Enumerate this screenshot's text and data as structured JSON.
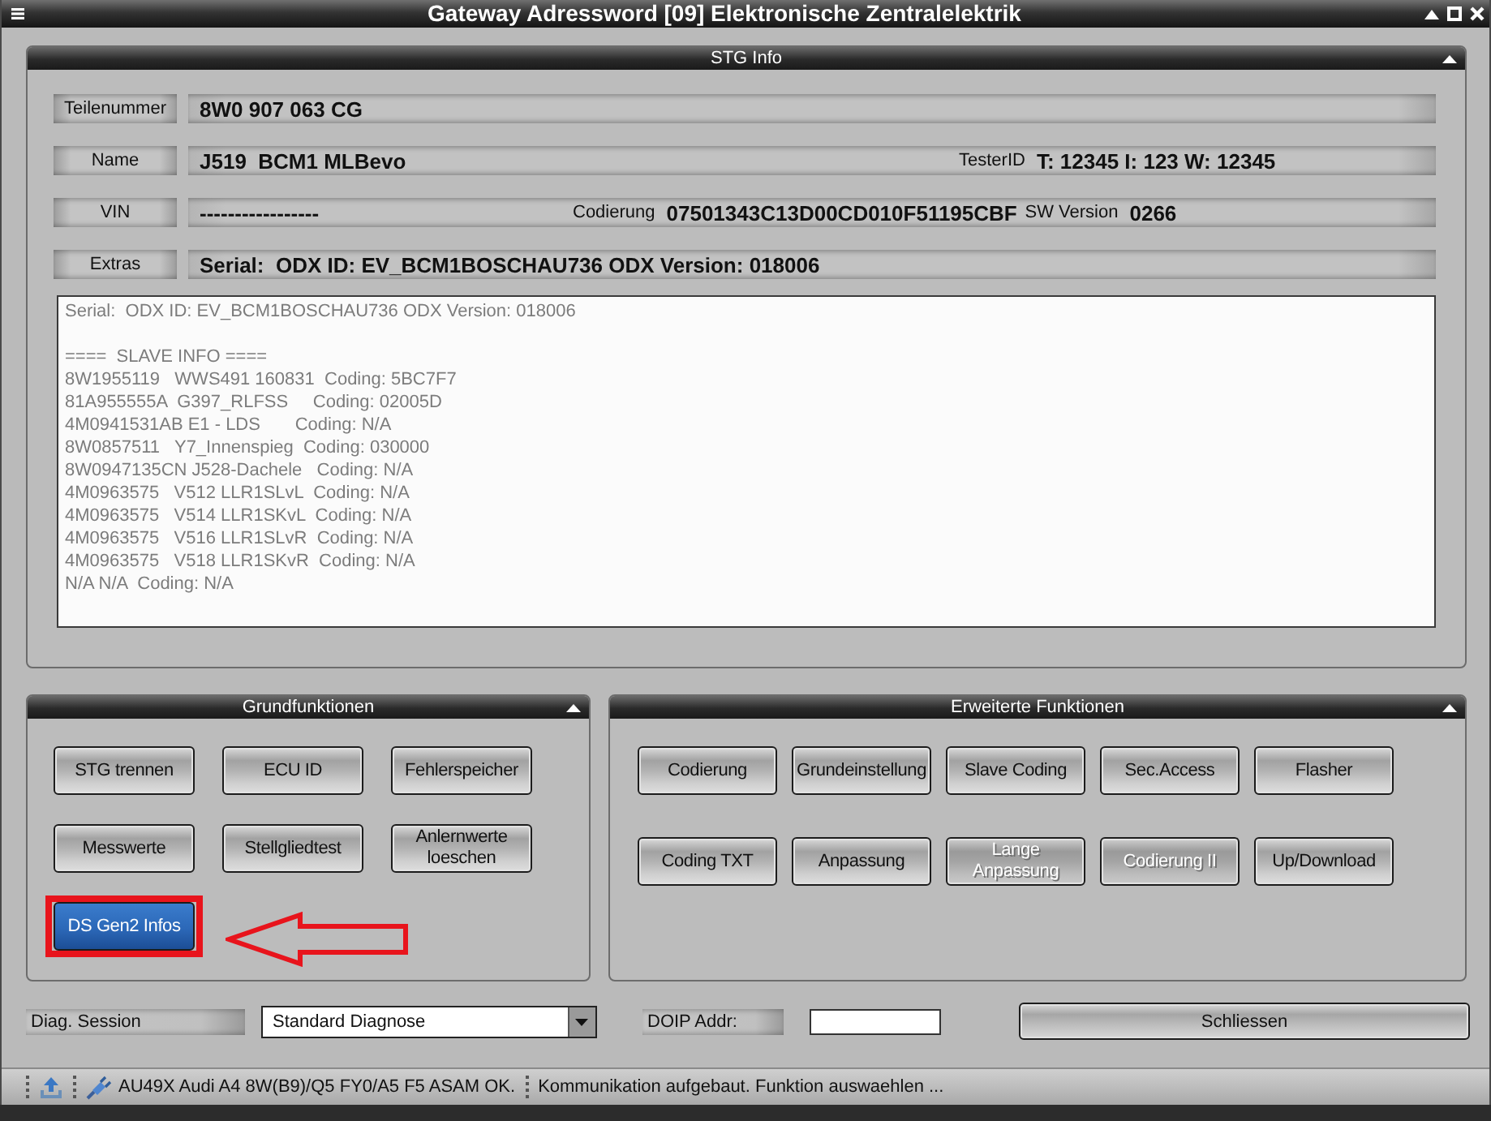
{
  "window": {
    "title": "Gateway Adressword [09] Elektronische Zentralelektrik"
  },
  "stg_info": {
    "title": "STG Info",
    "rows": [
      {
        "fields": [
          {
            "label": "Teilenummer",
            "value": "8W0 907 063 CG"
          }
        ]
      },
      {
        "fields": [
          {
            "label": "Name",
            "value": "J519  BCM1 MLBevo"
          },
          {
            "label": "TesterID",
            "value": "T: 12345 I: 123 W: 12345"
          }
        ]
      },
      {
        "fields": [
          {
            "label": "VIN",
            "value": "-----------------"
          },
          {
            "label": "Codierung",
            "value": "07501343C13D00CD010F51195CBF"
          },
          {
            "label": "SW Version",
            "value": "0266"
          }
        ]
      },
      {
        "fields": [
          {
            "label": "Extras",
            "value": "Serial:  ODX ID: EV_BCM1BOSCHAU736 ODX Version: 018006"
          }
        ]
      }
    ],
    "log": {
      "header": "Serial:  ODX ID: EV_BCM1BOSCHAU736 ODX Version: 018006",
      "slave_title": "====  SLAVE INFO ====",
      "slave_lines": [
        "8W1955119   WWS491 160831  Coding: 5BC7F7",
        "81A955555A  G397_RLFSS     Coding: 02005D",
        "4M0941531AB E1 - LDS       Coding: N/A",
        "8W0857511   Y7_Innenspieg  Coding: 030000",
        "8W0947135CN J528-Dachele   Coding: N/A",
        "4M0963575   V512 LLR1SLvL  Coding: N/A",
        "4M0963575   V514 LLR1SKvL  Coding: N/A",
        "4M0963575   V516 LLR1SLvR  Coding: N/A",
        "4M0963575   V518 LLR1SKvR  Coding: N/A",
        "N/A N/A  Coding: N/A"
      ]
    }
  },
  "grundfunktionen": {
    "title": "Grundfunktionen",
    "buttons": [
      {
        "label": "STG trennen",
        "disabled": false,
        "focused": false,
        "highlighted": false
      },
      {
        "label": "ECU ID",
        "disabled": false,
        "focused": false,
        "highlighted": false
      },
      {
        "label": "Fehlerspeicher",
        "disabled": false,
        "focused": false,
        "highlighted": false
      },
      {
        "label": "Messwerte",
        "disabled": false,
        "focused": false,
        "highlighted": false
      },
      {
        "label": "Stellgliedtest",
        "disabled": false,
        "focused": false,
        "highlighted": false
      },
      {
        "label": "Anlernwerte loeschen",
        "disabled": false,
        "focused": false,
        "highlighted": false
      },
      {
        "label": "DS Gen2 Infos",
        "disabled": false,
        "focused": true,
        "highlighted": true
      }
    ]
  },
  "erweiterte_funktionen": {
    "title": "Erweiterte Funktionen",
    "buttons": [
      {
        "label": "Codierung",
        "disabled": false,
        "focused": false,
        "highlighted": false
      },
      {
        "label": "Grundeinstellung",
        "disabled": false,
        "focused": false,
        "highlighted": false
      },
      {
        "label": "Slave Coding",
        "disabled": false,
        "focused": false,
        "highlighted": false
      },
      {
        "label": "Sec.Access",
        "disabled": false,
        "focused": false,
        "highlighted": false
      },
      {
        "label": "Flasher",
        "disabled": false,
        "focused": false,
        "highlighted": false
      },
      {
        "label": "Coding TXT",
        "disabled": false,
        "focused": false,
        "highlighted": false
      },
      {
        "label": "Anpassung",
        "disabled": false,
        "focused": false,
        "highlighted": false
      },
      {
        "label": "Lange Anpassung",
        "disabled": true,
        "focused": false,
        "highlighted": false
      },
      {
        "label": "Codierung II",
        "disabled": true,
        "focused": false,
        "highlighted": false
      },
      {
        "label": "Up/Download",
        "disabled": false,
        "focused": false,
        "highlighted": false
      }
    ]
  },
  "diag_session": {
    "label": "Diag. Session",
    "value": "Standard Diagnose"
  },
  "doip_addr": {
    "label": "DOIP Addr:"
  },
  "close_button": {
    "label": "Schliessen"
  },
  "status_bar": {
    "segments": [
      "AU49X Audi A4 8W(B9)/Q5 FY0/A5 F5 ASAM OK.",
      "Kommunikation aufgebaut. Funktion auswaehlen ..."
    ]
  }
}
